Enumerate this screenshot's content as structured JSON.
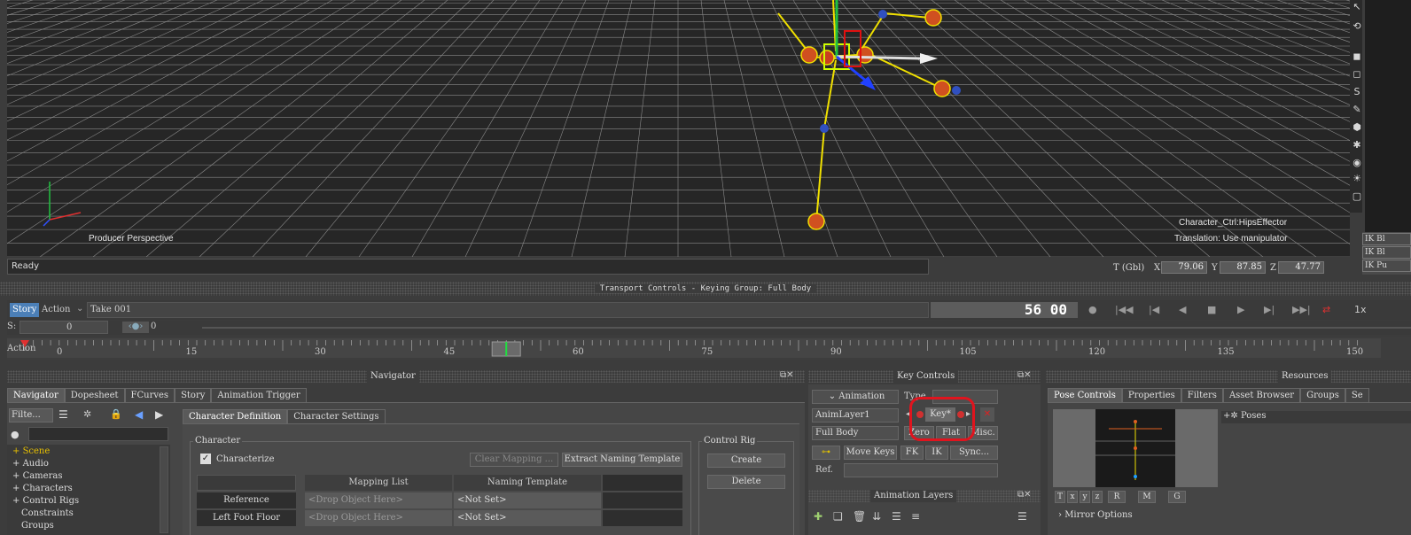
{
  "viewport": {
    "camera_label": "Producer Perspective",
    "selection_name": "Character_Ctrl:HipsEffector",
    "manipulator_hint": "Translation: Use manipulator"
  },
  "right_panel": {
    "ik_rows": [
      "IK Bl",
      "IK Bl",
      "IK Pu"
    ]
  },
  "status": {
    "text": "Ready",
    "coord_label": "T (Gbl)",
    "x_label": "X",
    "x_value": "79.06",
    "y_label": "Y",
    "y_value": "87.85",
    "z_label": "Z",
    "z_value": "47.77"
  },
  "transport": {
    "title": "Transport Controls  -  Keying Group: Full Body",
    "story_tab": "Story",
    "action_tab": "Action",
    "take": "Take 001",
    "frame": "56 00",
    "speed": "1x",
    "start_label": "S:",
    "start_value": "0",
    "end_value": "0",
    "timeline_label": "Action",
    "ticks": [
      "0",
      "15",
      "30",
      "45",
      "60",
      "75",
      "90",
      "105",
      "120",
      "135",
      "150"
    ],
    "current_frame": 56
  },
  "navigator": {
    "title": "Navigator",
    "tabs": [
      "Navigator",
      "Dopesheet",
      "FCurves",
      "Story",
      "Animation Trigger"
    ],
    "filter_label": "Filte...",
    "tree": [
      "Scene",
      "Audio",
      "Cameras",
      "Characters",
      "Control Rigs",
      "Constraints",
      "Groups"
    ],
    "char_tabs": [
      "Character Definition",
      "Character Settings"
    ],
    "character_group": "Character",
    "characterize_label": "Characterize",
    "clear_mapping": "Clear Mapping ...",
    "extract_template": "Extract Naming Template",
    "mapping_header": "Mapping List",
    "naming_header": "Naming Template",
    "rows": [
      {
        "name": "Reference",
        "mapping": "<Drop Object Here>",
        "template": "<Not Set>"
      },
      {
        "name": "Left Foot Floor",
        "mapping": "<Drop Object Here>",
        "template": "<Not Set>"
      }
    ],
    "control_rig_group": "Control Rig",
    "create_label": "Create",
    "delete_label": "Delete"
  },
  "key_controls": {
    "title": "Key Controls",
    "animation_label": "Animation",
    "type_label": "Type",
    "layer": "AnimLayer1",
    "key_button": "Key*",
    "body_part": "Full Body",
    "zero_button": "Zero",
    "flat_button": "Flat",
    "misc_button": "Misc.",
    "move_keys": "Move Keys",
    "fk_button": "FK",
    "ik_button": "IK",
    "sync_button": "Sync...",
    "ref_label": "Ref.",
    "anim_layers_title": "Animation Layers"
  },
  "resources": {
    "title": "Resources",
    "tabs": [
      "Pose Controls",
      "Properties",
      "Filters",
      "Asset Browser",
      "Groups",
      "Se"
    ],
    "poses_label": "Poses",
    "axis_buttons": [
      "T",
      "x",
      "y",
      "z",
      "R",
      "M",
      "G"
    ],
    "mirror_options": "Mirror Options"
  },
  "colors": {
    "accent": "#4b7fb7",
    "highlight_ring": "#e0141e",
    "skeleton": "#f0e000"
  }
}
